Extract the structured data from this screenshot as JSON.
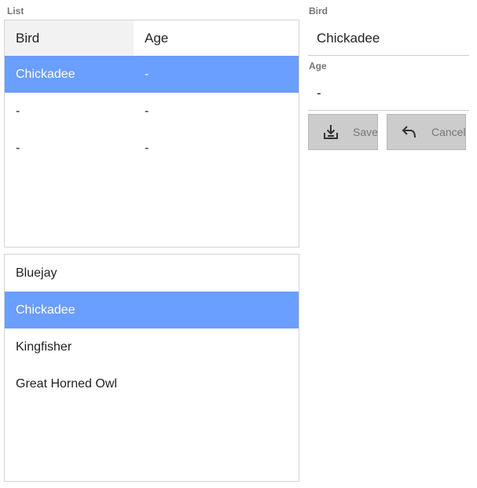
{
  "list_label": "List",
  "grid": {
    "columns": [
      "Bird",
      "Age"
    ],
    "rows": [
      {
        "bird": "Chickadee",
        "age": "-"
      },
      {
        "bird": "-",
        "age": "-"
      },
      {
        "bird": "-",
        "age": "-"
      }
    ],
    "selected_index": 0
  },
  "list": {
    "items": [
      "Bluejay",
      "Chickadee",
      "Kingfisher",
      "Great Horned Owl"
    ],
    "selected_index": 1
  },
  "form": {
    "bird_label": "Bird",
    "bird_value": "Chickadee",
    "age_label": "Age",
    "age_value": "-",
    "save_label": "Save",
    "cancel_label": "Cancel",
    "save_icon": "download-tray-icon",
    "cancel_icon": "undo-arrow-icon"
  },
  "colors": {
    "selection": "#6a9eff",
    "header_bg": "#f2f2f2",
    "button_bg": "#cccccc"
  }
}
